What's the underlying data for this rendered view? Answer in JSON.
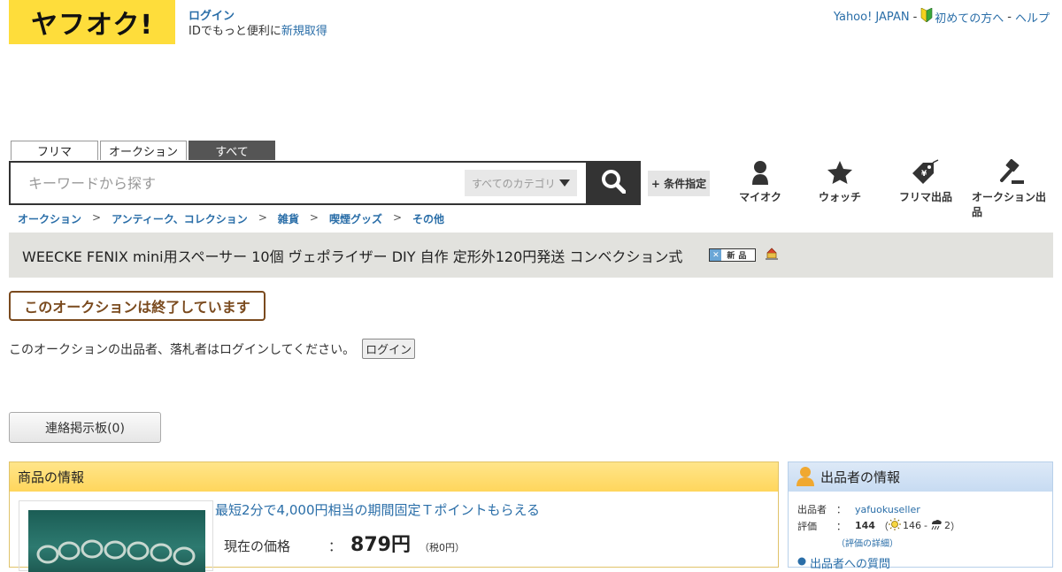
{
  "header": {
    "logo": "ヤフオク!",
    "login": "ログイン",
    "login_sub": "IDでもっと便利に",
    "register": "新規取得",
    "yahoo_japan": "Yahoo! JAPAN",
    "beginner": "初めての方へ",
    "help": "ヘルプ",
    "sep": "-"
  },
  "tabs": [
    {
      "label": "フリマ"
    },
    {
      "label": "オークション"
    },
    {
      "label": "すべて"
    }
  ],
  "search": {
    "placeholder": "キーワードから探す",
    "category": "すべてのカテゴリ",
    "condition": "+ 条件指定"
  },
  "nav": {
    "myauc": "マイオク",
    "watch": "ウォッチ",
    "flea_sell": "フリマ出品",
    "auction_sell": "オークション出品"
  },
  "breadcrumb": [
    "オークション",
    "アンティーク、コレクション",
    "雑貨",
    "喫煙グッズ",
    "その他"
  ],
  "breadcrumb_sep": ">",
  "item": {
    "title": "WEECKE FENIX mini用スペーサー 10個 ヴェポライザー DIY 自作 定形外120円発送 コンベクション式",
    "new_badge": "新品",
    "ended": "このオークションは終了しています",
    "login_message": "このオークションの出品者、落札者はログインしてください。",
    "login_button": "ログイン",
    "contact_board": "連絡掲示板(0)"
  },
  "item_info": {
    "header": "商品の情報",
    "promo": "最短2分で4,000円相当の期間固定Ｔポイントもらえる",
    "price_label": "現在の価格",
    "colon": "：",
    "price": "879円",
    "tax": "（税0円）"
  },
  "seller": {
    "header": "出品者の情報",
    "seller_label": "出品者",
    "seller_colon": "：",
    "seller_name": "yafuokuseller",
    "rating_label": "評価",
    "rating_total": "144",
    "rating_good": "146",
    "rating_bad": "2",
    "rating_open": "（",
    "rating_dash": "-",
    "rating_close": "）",
    "rating_detail": "（評価の詳細）",
    "question": "出品者への質問"
  }
}
